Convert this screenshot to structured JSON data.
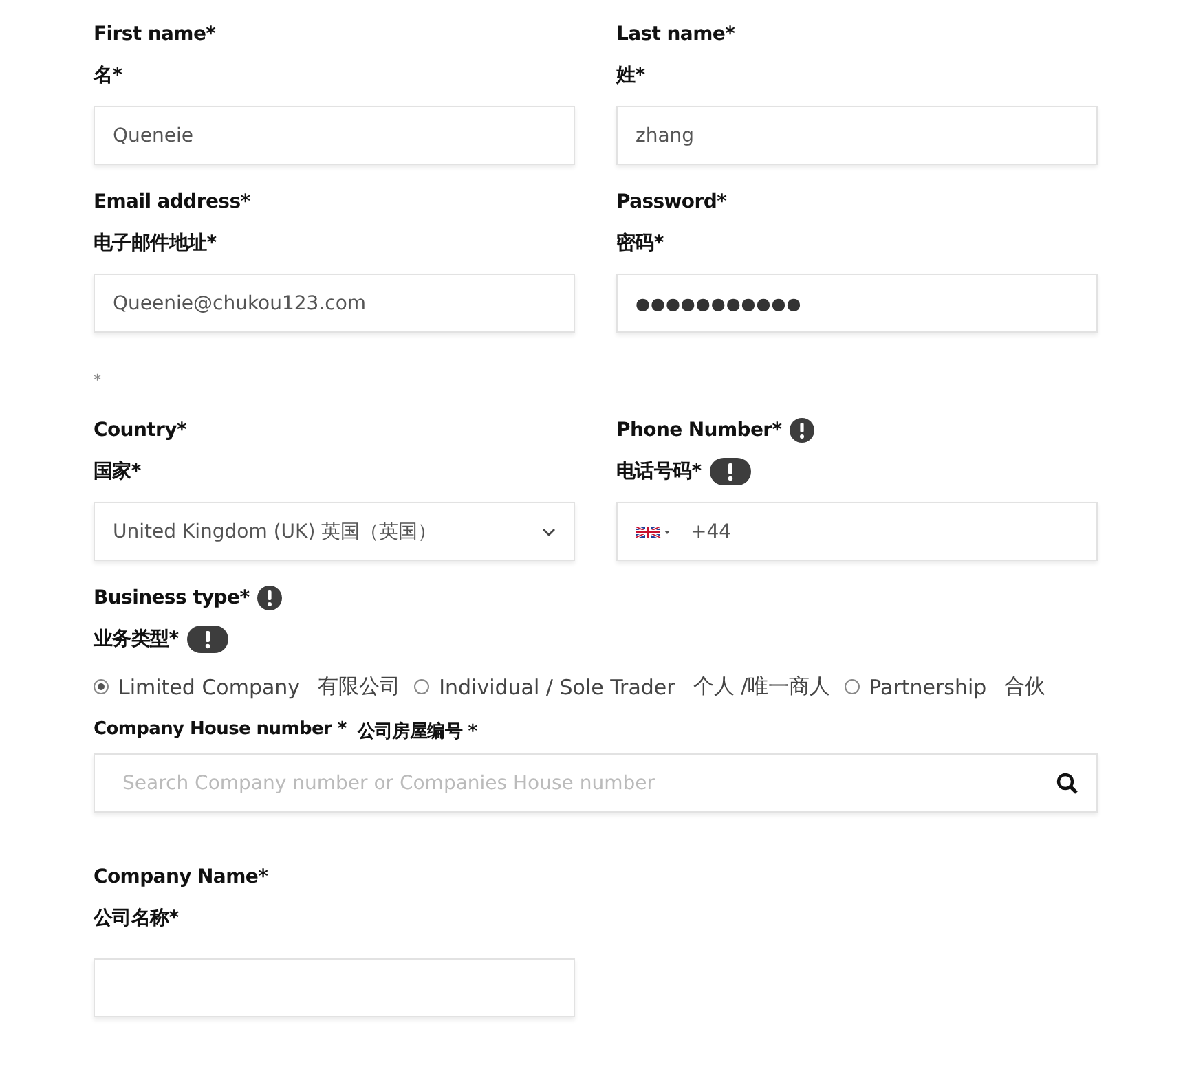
{
  "rows": [
    {
      "fields": [
        {
          "kind": "text",
          "label": "First name*",
          "label_zh": "名*",
          "info": false,
          "value": "Queneie"
        },
        {
          "kind": "text",
          "label": "Last name*",
          "label_zh": "姓*",
          "info": false,
          "value": "zhang"
        }
      ]
    },
    {
      "fields": [
        {
          "kind": "text",
          "label": "Email address*",
          "label_zh": "电子邮件地址*",
          "info": false,
          "value": "Queenie@chukou123.com"
        },
        {
          "kind": "password",
          "label": "Password*",
          "label_zh": "密码*",
          "info": false,
          "value": "●●●●●●●●●●●"
        }
      ],
      "note": "*"
    },
    {
      "fields": [
        {
          "kind": "select",
          "label": "Country*",
          "label_zh": "国家*",
          "info": false,
          "value": "United Kingdom (UK)  英国（英国）"
        },
        {
          "kind": "phone",
          "label": "Phone Number*",
          "label_zh": "电话号码*",
          "info": true,
          "value": "+44"
        }
      ]
    }
  ],
  "business_type": {
    "label": "Business type*",
    "label_zh": "业务类型*",
    "info": true,
    "options": [
      {
        "label": "Limited Company",
        "label_zh": "有限公司",
        "selected": true
      },
      {
        "label": "Individual / Sole Trader",
        "label_zh": "个人 /唯一商人",
        "selected": false
      },
      {
        "label": "Partnership",
        "label_zh": "合伙",
        "selected": false
      }
    ]
  },
  "company_house": {
    "label": "Company House number *",
    "label_zh": "公司房屋编号 *",
    "placeholder": "Search Company number or Companies House number"
  },
  "company_name": {
    "label": "Company Name*",
    "label_zh": "公司名称*"
  }
}
